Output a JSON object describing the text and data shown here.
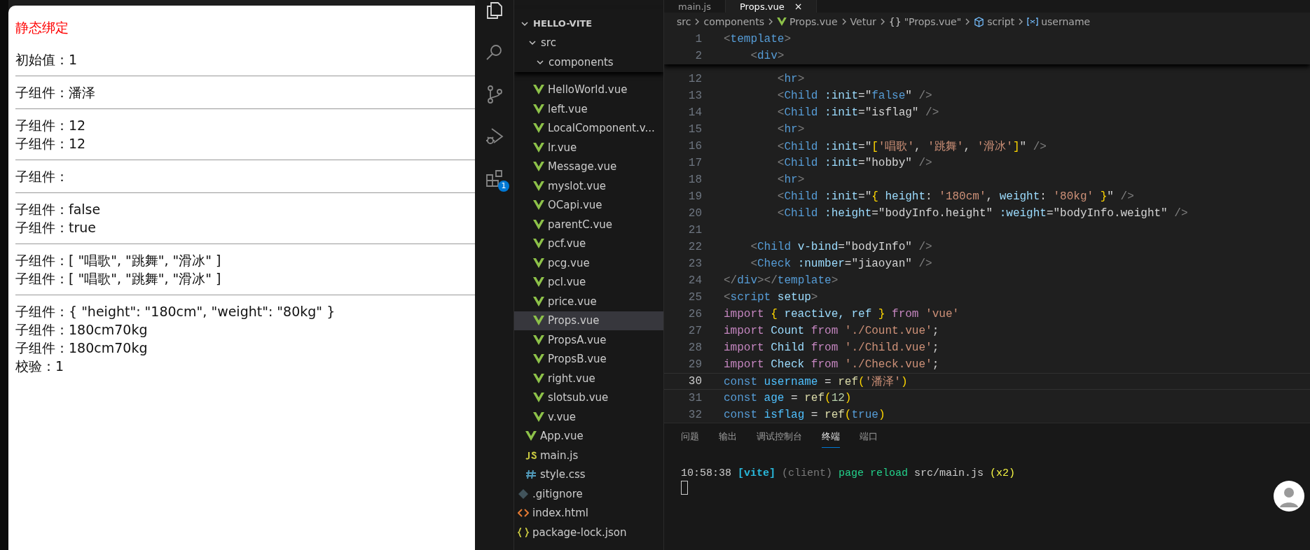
{
  "browser": {
    "heading": "静态绑定",
    "blocks": [
      [
        "初始值：1"
      ],
      [
        "子组件：潘泽"
      ],
      [
        "子组件：12",
        "子组件：12"
      ],
      [
        "子组件："
      ],
      [
        "子组件：false",
        "子组件：true"
      ],
      [
        "子组件：[ \"唱歌\", \"跳舞\", \"滑冰\" ]",
        "子组件：[ \"唱歌\", \"跳舞\", \"滑冰\" ]"
      ],
      [
        "子组件：{ \"height\": \"180cm\", \"weight\": \"80kg\" }",
        "子组件：180cm70kg",
        "子组件：180cm70kg",
        "校验：1"
      ]
    ]
  },
  "activity_bar": [
    {
      "kind": "files",
      "selected": true
    },
    {
      "kind": "search",
      "selected": false
    },
    {
      "kind": "source-control",
      "selected": false
    },
    {
      "kind": "run-debug",
      "selected": false
    },
    {
      "kind": "extensions",
      "selected": false,
      "badge": "1"
    }
  ],
  "explorer": {
    "tree": [
      {
        "label": "HELLO-VITE",
        "kind": "folder",
        "expanded": true,
        "children": [
          {
            "label": "src",
            "kind": "folder",
            "expanded": true,
            "children": [
              {
                "label": "components",
                "kind": "folder",
                "expanded": true,
                "children": [
                  {
                    "label": "HelloWorld.vue",
                    "kind": "vue",
                    "selected": false
                  },
                  {
                    "label": "left.vue",
                    "kind": "vue",
                    "selected": false
                  },
                  {
                    "label": "LocalComponent.v...",
                    "kind": "vue",
                    "selected": false
                  },
                  {
                    "label": "lr.vue",
                    "kind": "vue",
                    "selected": false
                  },
                  {
                    "label": "Message.vue",
                    "kind": "vue",
                    "selected": false
                  },
                  {
                    "label": "myslot.vue",
                    "kind": "vue",
                    "selected": false
                  },
                  {
                    "label": "OCapi.vue",
                    "kind": "vue",
                    "selected": false
                  },
                  {
                    "label": "parentC.vue",
                    "kind": "vue",
                    "selected": false
                  },
                  {
                    "label": "pcf.vue",
                    "kind": "vue",
                    "selected": false
                  },
                  {
                    "label": "pcg.vue",
                    "kind": "vue",
                    "selected": false
                  },
                  {
                    "label": "pcl.vue",
                    "kind": "vue",
                    "selected": false
                  },
                  {
                    "label": "price.vue",
                    "kind": "vue",
                    "selected": false
                  },
                  {
                    "label": "Props.vue",
                    "kind": "vue",
                    "selected": true
                  },
                  {
                    "label": "PropsA.vue",
                    "kind": "vue",
                    "selected": false
                  },
                  {
                    "label": "PropsB.vue",
                    "kind": "vue",
                    "selected": false
                  },
                  {
                    "label": "right.vue",
                    "kind": "vue",
                    "selected": false
                  },
                  {
                    "label": "slotsub.vue",
                    "kind": "vue",
                    "selected": false
                  },
                  {
                    "label": "v.vue",
                    "kind": "vue",
                    "selected": false
                  }
                ]
              },
              {
                "label": "App.vue",
                "kind": "vue",
                "selected": false
              },
              {
                "label": "main.js",
                "kind": "js",
                "selected": false
              },
              {
                "label": "style.css",
                "kind": "css",
                "selected": false
              }
            ]
          },
          {
            "label": ".gitignore",
            "kind": "git",
            "selected": false
          },
          {
            "label": "index.html",
            "kind": "html",
            "selected": false
          },
          {
            "label": "package-lock.json",
            "kind": "json",
            "selected": false
          }
        ]
      }
    ]
  },
  "editor_tabs": [
    {
      "label": "main.js",
      "selected": false
    },
    {
      "label": "Props.vue",
      "selected": true,
      "close": "×"
    }
  ],
  "breadcrumbs": [
    {
      "kind": "folder",
      "label": "src"
    },
    {
      "kind": "folder",
      "label": "components"
    },
    {
      "kind": "vue",
      "label": "Props.vue"
    },
    {
      "kind": "folder",
      "label": "Vetur"
    },
    {
      "kind": "braces",
      "icon": "{}",
      "label": "\"Props.vue\""
    },
    {
      "kind": "cube",
      "label": "script"
    },
    {
      "kind": "variable",
      "label": "username"
    }
  ],
  "sticky_lines": [
    {
      "n": "1",
      "t": [
        {
          "text": "<",
          "kind": "p"
        },
        {
          "text": "template",
          "kind": "tag"
        },
        {
          "text": ">",
          "kind": "p"
        }
      ]
    },
    {
      "n": "2",
      "t": [
        {
          "text": "    <",
          "kind": "p"
        },
        {
          "text": "div",
          "kind": "tag"
        },
        {
          "text": ">",
          "kind": "p"
        }
      ]
    }
  ],
  "code_lines": [
    {
      "n": "12",
      "t": [
        {
          "text": "        <",
          "kind": "p"
        },
        {
          "text": "hr",
          "kind": "tag"
        },
        {
          "text": ">",
          "kind": "p"
        }
      ]
    },
    {
      "n": "13",
      "t": [
        {
          "text": "        <",
          "kind": "p"
        },
        {
          "text": "Child",
          "kind": "tag"
        },
        {
          "text": " :init",
          "kind": "attr"
        },
        {
          "text": "=\"",
          "kind": "eq"
        },
        {
          "text": "false",
          "kind": "dec"
        },
        {
          "text": "\"",
          "kind": "eq"
        },
        {
          "text": " />",
          "kind": "p"
        }
      ]
    },
    {
      "n": "14",
      "t": [
        {
          "text": "        <",
          "kind": "p"
        },
        {
          "text": "Child",
          "kind": "tag"
        },
        {
          "text": " :init",
          "kind": "attr"
        },
        {
          "text": "=\"isflag\"",
          "kind": "eq"
        },
        {
          "text": " />",
          "kind": "p"
        }
      ]
    },
    {
      "n": "15",
      "t": [
        {
          "text": "        <",
          "kind": "p"
        },
        {
          "text": "hr",
          "kind": "tag"
        },
        {
          "text": ">",
          "kind": "p"
        }
      ]
    },
    {
      "n": "16",
      "t": [
        {
          "text": "        <",
          "kind": "p"
        },
        {
          "text": "Child",
          "kind": "tag"
        },
        {
          "text": " :init",
          "kind": "attr"
        },
        {
          "text": "=\"",
          "kind": "eq"
        },
        {
          "text": "[",
          "kind": "br"
        },
        {
          "text": "'唱歌'",
          "kind": "str"
        },
        {
          "text": ", ",
          "kind": "eq"
        },
        {
          "text": "'跳舞'",
          "kind": "str"
        },
        {
          "text": ", ",
          "kind": "eq"
        },
        {
          "text": "'滑冰'",
          "kind": "str"
        },
        {
          "text": "]",
          "kind": "br"
        },
        {
          "text": "\"",
          "kind": "eq"
        },
        {
          "text": " />",
          "kind": "p"
        }
      ]
    },
    {
      "n": "17",
      "t": [
        {
          "text": "        <",
          "kind": "p"
        },
        {
          "text": "Child",
          "kind": "tag"
        },
        {
          "text": " :init",
          "kind": "attr"
        },
        {
          "text": "=\"hobby\"",
          "kind": "eq"
        },
        {
          "text": " />",
          "kind": "p"
        }
      ]
    },
    {
      "n": "18",
      "t": [
        {
          "text": "        <",
          "kind": "p"
        },
        {
          "text": "hr",
          "kind": "tag"
        },
        {
          "text": ">",
          "kind": "p"
        }
      ]
    },
    {
      "n": "19",
      "t": [
        {
          "text": "        <",
          "kind": "p"
        },
        {
          "text": "Child",
          "kind": "tag"
        },
        {
          "text": " :init",
          "kind": "attr"
        },
        {
          "text": "=\"",
          "kind": "eq"
        },
        {
          "text": "{",
          "kind": "br"
        },
        {
          "text": " height",
          "kind": "attr"
        },
        {
          "text": ": ",
          "kind": "eq"
        },
        {
          "text": "'180cm'",
          "kind": "str"
        },
        {
          "text": ", ",
          "kind": "eq"
        },
        {
          "text": "weight",
          "kind": "attr"
        },
        {
          "text": ": ",
          "kind": "eq"
        },
        {
          "text": "'80kg'",
          "kind": "str"
        },
        {
          "text": " }",
          "kind": "br"
        },
        {
          "text": "\"",
          "kind": "eq"
        },
        {
          "text": " />",
          "kind": "p"
        }
      ]
    },
    {
      "n": "20",
      "t": [
        {
          "text": "        <",
          "kind": "p"
        },
        {
          "text": "Child",
          "kind": "tag"
        },
        {
          "text": " :height",
          "kind": "attr"
        },
        {
          "text": "=\"bodyInfo.height\"",
          "kind": "eq"
        },
        {
          "text": " :weight",
          "kind": "attr"
        },
        {
          "text": "=\"bodyInfo.weight\"",
          "kind": "eq"
        },
        {
          "text": " />",
          "kind": "p"
        }
      ]
    },
    {
      "n": "21"
    },
    {
      "n": "22",
      "t": [
        {
          "text": "    <",
          "kind": "p"
        },
        {
          "text": "Child",
          "kind": "tag"
        },
        {
          "text": " v-bind",
          "kind": "attr"
        },
        {
          "text": "=\"bodyInfo\"",
          "kind": "eq"
        },
        {
          "text": " />",
          "kind": "p"
        }
      ]
    },
    {
      "n": "23",
      "t": [
        {
          "text": "    <",
          "kind": "p"
        },
        {
          "text": "Check",
          "kind": "tag"
        },
        {
          "text": " :number",
          "kind": "attr"
        },
        {
          "text": "=\"jiaoyan\"",
          "kind": "eq"
        },
        {
          "text": " />",
          "kind": "p"
        }
      ]
    },
    {
      "n": "24",
      "t": [
        {
          "text": "</",
          "kind": "p"
        },
        {
          "text": "div",
          "kind": "tag"
        },
        {
          "text": "></",
          "kind": "p"
        },
        {
          "text": "template",
          "kind": "tag"
        },
        {
          "text": ">",
          "kind": "p"
        }
      ]
    },
    {
      "n": "25",
      "t": [
        {
          "text": "<",
          "kind": "p"
        },
        {
          "text": "script",
          "kind": "tag"
        },
        {
          "text": " setup",
          "kind": "attr"
        },
        {
          "text": ">",
          "kind": "p"
        }
      ]
    },
    {
      "n": "26",
      "t": [
        {
          "text": "import",
          "kind": "kw"
        },
        {
          "text": " {",
          "kind": "br"
        },
        {
          "text": " reactive, ref ",
          "kind": "id"
        },
        {
          "text": "}",
          "kind": "br"
        },
        {
          "text": " from",
          "kind": "kw"
        },
        {
          "text": " 'vue'",
          "kind": "str"
        }
      ]
    },
    {
      "n": "27",
      "t": [
        {
          "text": "import",
          "kind": "kw"
        },
        {
          "text": " Count",
          "kind": "id"
        },
        {
          "text": " from",
          "kind": "kw"
        },
        {
          "text": " './Count.vue'",
          "kind": "str"
        },
        {
          "text": ";",
          "kind": "eq"
        }
      ]
    },
    {
      "n": "28",
      "t": [
        {
          "text": "import",
          "kind": "kw"
        },
        {
          "text": " Child",
          "kind": "id"
        },
        {
          "text": " from",
          "kind": "kw"
        },
        {
          "text": " './Child.vue'",
          "kind": "str"
        },
        {
          "text": ";",
          "kind": "eq"
        }
      ]
    },
    {
      "n": "29",
      "t": [
        {
          "text": "import",
          "kind": "kw"
        },
        {
          "text": " Check",
          "kind": "id"
        },
        {
          "text": " from",
          "kind": "kw"
        },
        {
          "text": " './Check.vue'",
          "kind": "str"
        },
        {
          "text": ";",
          "kind": "eq"
        }
      ]
    },
    {
      "n": "30",
      "current": true,
      "t": [
        {
          "text": "const",
          "kind": "dec"
        },
        {
          "text": " username",
          "kind": "var"
        },
        {
          "text": " = ",
          "kind": "eq"
        },
        {
          "text": "ref",
          "kind": "fn"
        },
        {
          "text": "(",
          "kind": "br"
        },
        {
          "text": "'潘泽'",
          "kind": "str"
        },
        {
          "text": ")",
          "kind": "br"
        }
      ]
    },
    {
      "n": "31",
      "t": [
        {
          "text": "const",
          "kind": "dec"
        },
        {
          "text": " age",
          "kind": "var"
        },
        {
          "text": " = ",
          "kind": "eq"
        },
        {
          "text": "ref",
          "kind": "fn"
        },
        {
          "text": "(",
          "kind": "br"
        },
        {
          "text": "12",
          "kind": "num"
        },
        {
          "text": ")",
          "kind": "br"
        }
      ]
    },
    {
      "n": "32",
      "t": [
        {
          "text": "const",
          "kind": "dec"
        },
        {
          "text": " isflag",
          "kind": "var"
        },
        {
          "text": " = ",
          "kind": "eq"
        },
        {
          "text": "ref",
          "kind": "fn"
        },
        {
          "text": "(",
          "kind": "br"
        },
        {
          "text": "true",
          "kind": "dec"
        },
        {
          "text": ")",
          "kind": "br"
        }
      ]
    }
  ],
  "panel_tabs": [
    {
      "label": "问题",
      "selected": false
    },
    {
      "label": "输出",
      "selected": false
    },
    {
      "label": "调试控制台",
      "selected": false
    },
    {
      "label": "终端",
      "selected": true
    },
    {
      "label": "端口",
      "selected": false
    }
  ],
  "terminal": [
    {
      "text": "10:58:38 ",
      "kind": "plain"
    },
    {
      "text": "[vite]",
      "kind": "vite"
    },
    {
      "text": " (client)",
      "kind": "dim"
    },
    {
      "text": " page reload",
      "kind": "green"
    },
    {
      "text": " src/main.js",
      "kind": "plain"
    },
    {
      "text": " (x2)",
      "kind": "yellow"
    }
  ]
}
